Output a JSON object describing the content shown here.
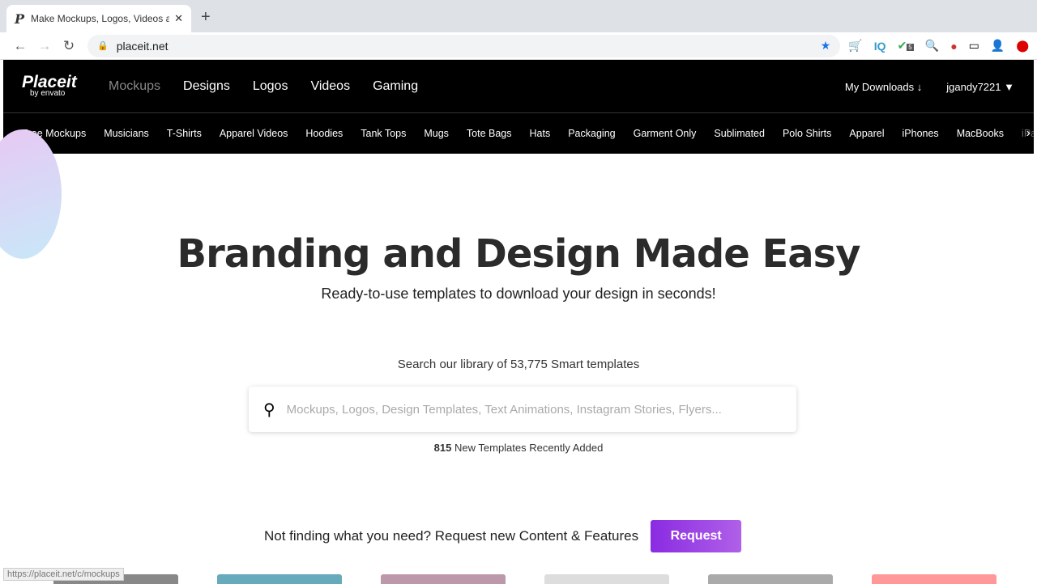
{
  "browser": {
    "tab_title": "Make Mockups, Logos, Videos and Designs",
    "url": "placeit.net",
    "status_url": "https://placeit.net/c/mockups",
    "extension_badge": "5"
  },
  "header": {
    "logo": "Placeit",
    "logo_sub": "by envato",
    "nav": [
      "Mockups",
      "Designs",
      "Logos",
      "Videos",
      "Gaming"
    ],
    "downloads": "My Downloads ↓",
    "user": "jgandy7221"
  },
  "subnav": [
    "Free Mockups",
    "Musicians",
    "T-Shirts",
    "Apparel Videos",
    "Hoodies",
    "Tank Tops",
    "Mugs",
    "Tote Bags",
    "Hats",
    "Packaging",
    "Garment Only",
    "Sublimated",
    "Polo Shirts",
    "Apparel",
    "iPhones",
    "MacBooks",
    "iPads"
  ],
  "hero": {
    "title": "Branding and Design Made Easy",
    "subtitle": "Ready-to-use templates to download your design in seconds!",
    "library": "Search our library of 53,775 Smart templates",
    "placeholder": "Mockups, Logos, Design Templates, Text Animations, Instagram Stories, Flyers...",
    "recent_count": "815",
    "recent_text": "New Templates Recently Added"
  },
  "request": {
    "text": "Not finding what you need? Request new Content & Features",
    "button": "Request"
  },
  "colors": {
    "accent": "#8a2be2"
  }
}
